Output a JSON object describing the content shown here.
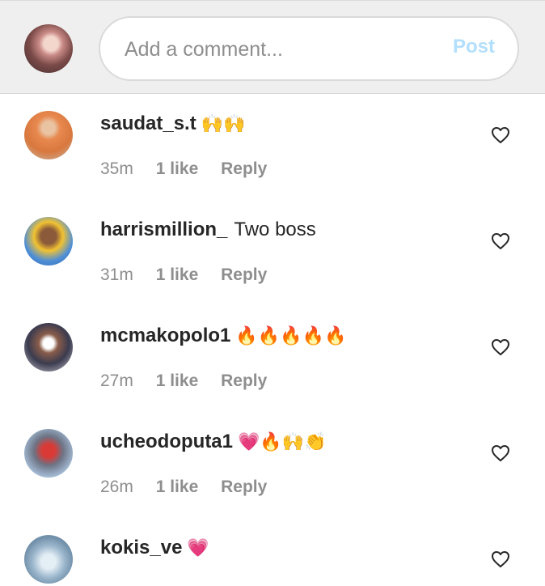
{
  "composer": {
    "placeholder": "Add a comment...",
    "post_label": "Post"
  },
  "comments": [
    {
      "username": "saudat_s.t",
      "text": "",
      "emoji": "🙌🙌",
      "time": "35m",
      "likes": "1 like",
      "reply": "Reply"
    },
    {
      "username": "harrismillion_",
      "text": "Two boss",
      "emoji": "",
      "time": "31m",
      "likes": "1 like",
      "reply": "Reply"
    },
    {
      "username": "mcmakopolo1",
      "text": "",
      "emoji": "🔥🔥🔥🔥🔥",
      "time": "27m",
      "likes": "1 like",
      "reply": "Reply"
    },
    {
      "username": "ucheodoputa1",
      "text": "",
      "emoji": "💗🔥🙌👏",
      "time": "26m",
      "likes": "1 like",
      "reply": "Reply"
    },
    {
      "username": "kokis_ve",
      "text": "",
      "emoji": "💗",
      "time": "",
      "likes": "",
      "reply": ""
    }
  ],
  "icons": {
    "like": "heart-outline-icon"
  },
  "colors": {
    "post_disabled": "#b2dffc",
    "meta_gray": "#8e8e8e",
    "text": "#262626"
  }
}
